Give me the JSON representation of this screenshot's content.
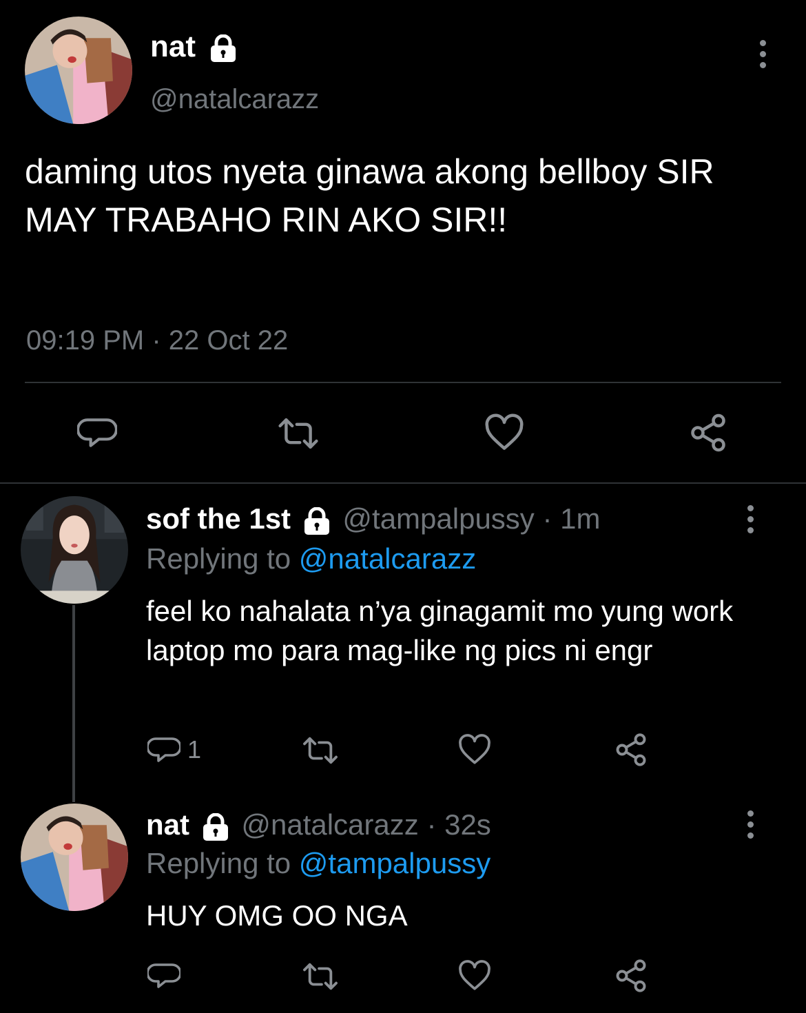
{
  "main_tweet": {
    "author_name": "nat",
    "author_handle": "@natalcarazz",
    "protected": true,
    "text": "daming utos nyeta ginawa akong bellboy SIR MAY TRABAHO RIN AKO SIR!!",
    "timestamp": "09:19 PM · 22 Oct 22"
  },
  "replies": [
    {
      "author_name": "sof the 1st",
      "author_handle": "@tampalpussy",
      "time": "· 1m",
      "replying_prefix": "Replying to",
      "replying_to": "@natalcarazz",
      "text": "feel ko nahalata n’ya ginagamit mo yung work laptop mo para mag-like ng pics ni engr",
      "reply_count": "1"
    },
    {
      "author_name": "nat",
      "author_handle": "@natalcarazz",
      "time": "· 32s",
      "replying_prefix": "Replying to",
      "replying_to": "@tampalpussy",
      "text": "HUY OMG OO NGA",
      "reply_count": ""
    }
  ],
  "icons": {
    "reply": "reply-icon",
    "retweet": "retweet-icon",
    "like": "heart-icon",
    "share": "share-icon",
    "more": "more-vertical-icon",
    "lock": "lock-icon"
  },
  "colors": {
    "background": "#000000",
    "text": "#e7e9ea",
    "muted": "#71767b",
    "link": "#1d9bf0",
    "divider": "#2f3336"
  }
}
